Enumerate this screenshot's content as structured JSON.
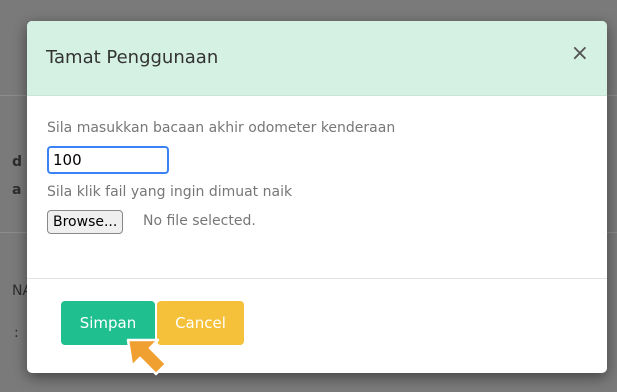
{
  "modal": {
    "title": "Tamat Penggunaan",
    "close_glyph": "×",
    "odometer_label": "Sila masukkan bacaan akhir odometer kenderaan",
    "odometer_value": "100",
    "upload_label": "Sila klik fail yang ingin dimuat naik",
    "browse_label": "Browse...",
    "file_status": "No file selected.",
    "save_label": "Simpan",
    "cancel_label": "Cancel"
  },
  "background": {
    "fragments": [
      "d",
      "a",
      "NA",
      ":"
    ]
  },
  "colors": {
    "header_bg": "#d5f1e4",
    "save_bg": "#1fbf8f",
    "cancel_bg": "#f6c13a",
    "cursor": "#f0a030"
  },
  "icons": {
    "close": "close-icon",
    "cursor": "cursor-arrow-icon"
  }
}
